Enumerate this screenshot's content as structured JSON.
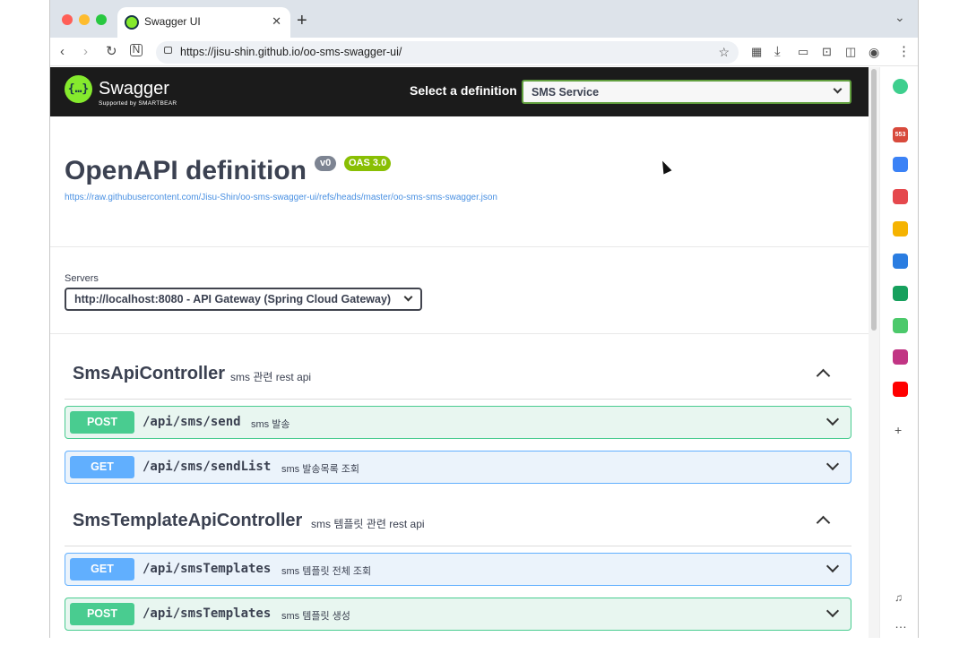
{
  "browser": {
    "tab_title": "Swagger UI",
    "url": "https://jisu-shin.github.io/oo-sms-swagger-ui/"
  },
  "swagger": {
    "logo_text": "Swagger",
    "logo_sub": "Supported by SMARTBEAR",
    "definition_label": "Select a definition",
    "definition_value": "SMS Service",
    "title": "OpenAPI definition",
    "version_badge": "v0",
    "oas_badge": "OAS 3.0",
    "spec_url": "https://raw.githubusercontent.com/Jisu-Shin/oo-sms-swagger-ui/refs/heads/master/oo-sms-sms-swagger.json",
    "servers_label": "Servers",
    "server_value": "http://localhost:8080 - API Gateway (Spring Cloud Gateway)"
  },
  "tags": [
    {
      "name": "SmsApiController",
      "description": "sms 관련 rest api",
      "operations": [
        {
          "method": "POST",
          "path": "/api/sms/send",
          "summary": "sms 발송"
        },
        {
          "method": "GET",
          "path": "/api/sms/sendList",
          "summary": "sms 발송목록 조회"
        }
      ]
    },
    {
      "name": "SmsTemplateApiController",
      "description": "sms 템플릿 관련 rest api",
      "operations": [
        {
          "method": "GET",
          "path": "/api/smsTemplates",
          "summary": "sms 템플릿 전체 조회"
        },
        {
          "method": "POST",
          "path": "/api/smsTemplates",
          "summary": "sms 템플릿 생성"
        }
      ]
    }
  ],
  "sidebar": {
    "badge_count": "553"
  },
  "colors": {
    "post": "#49cc90",
    "get": "#61afe",
    "swagger_green": "#85ea2d",
    "topbar": "#1b1b1b"
  },
  "icons": [
    "back-icon",
    "forward-icon",
    "reload-icon",
    "lock-icon",
    "star-icon",
    "download-icon",
    "menu-icon",
    "chevron-down-icon",
    "chevron-up-icon"
  ]
}
